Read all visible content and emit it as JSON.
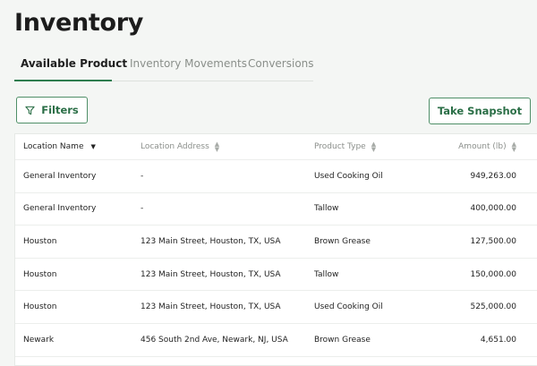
{
  "page": {
    "title": "Inventory"
  },
  "tabs": [
    {
      "label": "Available Product"
    },
    {
      "label": "Inventory Movements"
    },
    {
      "label": "Conversions"
    }
  ],
  "toolbar": {
    "filters_label": "Filters",
    "snapshot_label": "Take Snapshot"
  },
  "table": {
    "columns": [
      "Location Name",
      "Location Address",
      "Product Type",
      "Amount (lb)"
    ],
    "rows": [
      [
        "General Inventory",
        "-",
        "Used Cooking Oil",
        "949,263.00"
      ],
      [
        "General Inventory",
        "-",
        "Tallow",
        "400,000.00"
      ],
      [
        "Houston",
        "123 Main Street, Houston, TX, USA",
        "Brown Grease",
        "127,500.00"
      ],
      [
        "Houston",
        "123 Main Street, Houston, TX, USA",
        "Tallow",
        "150,000.00"
      ],
      [
        "Houston",
        "123 Main Street, Houston, TX, USA",
        "Used Cooking Oil",
        "525,000.00"
      ],
      [
        "Newark",
        "456 South 2nd Ave, Newark, NJ, USA",
        "Brown Grease",
        "4,651.00"
      ]
    ]
  },
  "icons": {
    "filter": "filter-icon",
    "sort": "sort-icon",
    "sort_desc": "sort-desc-icon"
  },
  "colors": {
    "accent": "#2e7d4f",
    "button_text": "#2a6e46"
  }
}
